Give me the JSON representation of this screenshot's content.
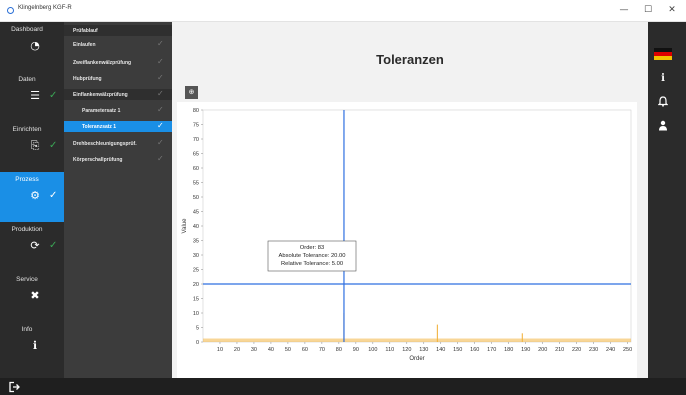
{
  "window": {
    "title": "Klingelnberg KGF-R",
    "minimize": "—",
    "maximize": "☐",
    "close": "✕"
  },
  "leftnav": {
    "items": [
      {
        "label": "Dashboard",
        "icon": "gauge-icon",
        "glyph": "◔",
        "check": ""
      },
      {
        "label": "Daten",
        "icon": "data-list-icon",
        "glyph": "☰",
        "check": "✓"
      },
      {
        "label": "Einrichten",
        "icon": "setup-icon",
        "glyph": "⎘",
        "check": "✓"
      },
      {
        "label": "Prozess",
        "icon": "gears-icon",
        "glyph": "⚙",
        "check": "✓"
      },
      {
        "label": "Produktion",
        "icon": "cycle-icon",
        "glyph": "⟳",
        "check": "✓"
      },
      {
        "label": "Service",
        "icon": "tools-icon",
        "glyph": "✖",
        "check": ""
      },
      {
        "label": "Info",
        "icon": "info-icon",
        "glyph": "ℹ",
        "check": ""
      }
    ]
  },
  "subnav": {
    "items": [
      {
        "label": "Prüfablauf",
        "check": ""
      },
      {
        "label": "Einlaufen",
        "check": "✓"
      },
      {
        "label": "Zweiflankenwälzprüfung",
        "check": "✓"
      },
      {
        "label": "Hubprüfung",
        "check": "✓"
      },
      {
        "label": "Einflankenwälzprüfung",
        "check": "✓"
      },
      {
        "label": "Parametersatz 1",
        "check": "✓"
      },
      {
        "label": "Toleranzsatz 1",
        "check": "✓"
      },
      {
        "label": "Drehbeschleunigungsprüf.",
        "check": "✓"
      },
      {
        "label": "Körperschallprüfung",
        "check": "✓"
      }
    ]
  },
  "content": {
    "title": "Toleranzen",
    "zoom_label": "⊕"
  },
  "tooltip": {
    "line1": "Order: 83",
    "line2": "Absolute Tolerance: 20.00",
    "line3": "Relative Tolerance: 5.00"
  },
  "chart_data": {
    "type": "line",
    "xlabel": "Order",
    "ylabel": "Value",
    "xlim": [
      0,
      252
    ],
    "ylim": [
      0,
      80
    ],
    "xticks": [
      10,
      20,
      30,
      40,
      50,
      60,
      70,
      80,
      90,
      100,
      110,
      120,
      130,
      140,
      150,
      160,
      170,
      180,
      190,
      200,
      210,
      220,
      230,
      240,
      250
    ],
    "yticks": [
      0,
      5,
      10,
      15,
      20,
      25,
      30,
      35,
      40,
      45,
      50,
      55,
      60,
      65,
      70,
      75,
      80
    ],
    "tolerance_line": 20,
    "cursor_x": 83,
    "colors": {
      "tolerance": "#2f6fe0",
      "cursor": "#2f6fe0",
      "spectrum": "#f2b441"
    },
    "spectrum_peaks": [
      {
        "x": 83,
        "y": 10
      },
      {
        "x": 138,
        "y": 6
      },
      {
        "x": 188,
        "y": 3
      }
    ]
  },
  "rightbar": {
    "icons": [
      {
        "name": "language-flag-icon"
      },
      {
        "name": "info-icon",
        "glyph": "i"
      },
      {
        "name": "bell-icon",
        "glyph": "🔔"
      },
      {
        "name": "user-icon",
        "glyph": "♟"
      }
    ]
  },
  "bottombar": {
    "logout_glyph": "⇥"
  }
}
